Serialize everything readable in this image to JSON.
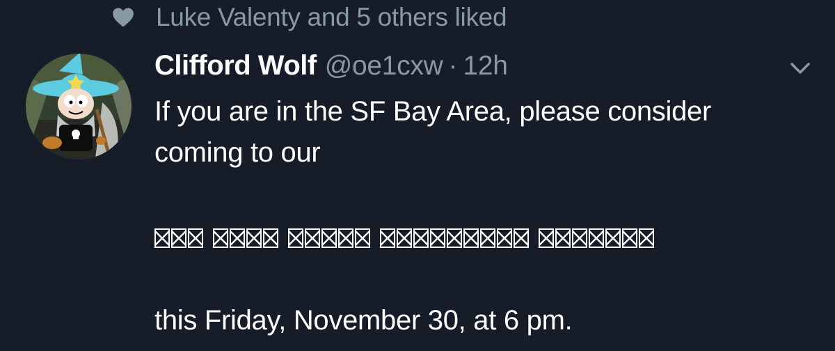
{
  "social_context": {
    "text": "Luke Valenty and 5 others liked",
    "icon": "heart-icon"
  },
  "tweet": {
    "author_name": "Clifford Wolf",
    "author_handle": "@oe1cxw",
    "separator": "·",
    "timestamp": "12h",
    "lines": [
      "If you are in the SF Bay Area, please consider",
      "coming to our",
      "this Friday, November 30, at 6 pm."
    ],
    "unrendered_word_lengths": [
      3,
      4,
      5,
      9,
      7
    ]
  },
  "colors": {
    "background": "#161d28",
    "primary_text": "#ffffff",
    "secondary_text": "#8899a6"
  }
}
